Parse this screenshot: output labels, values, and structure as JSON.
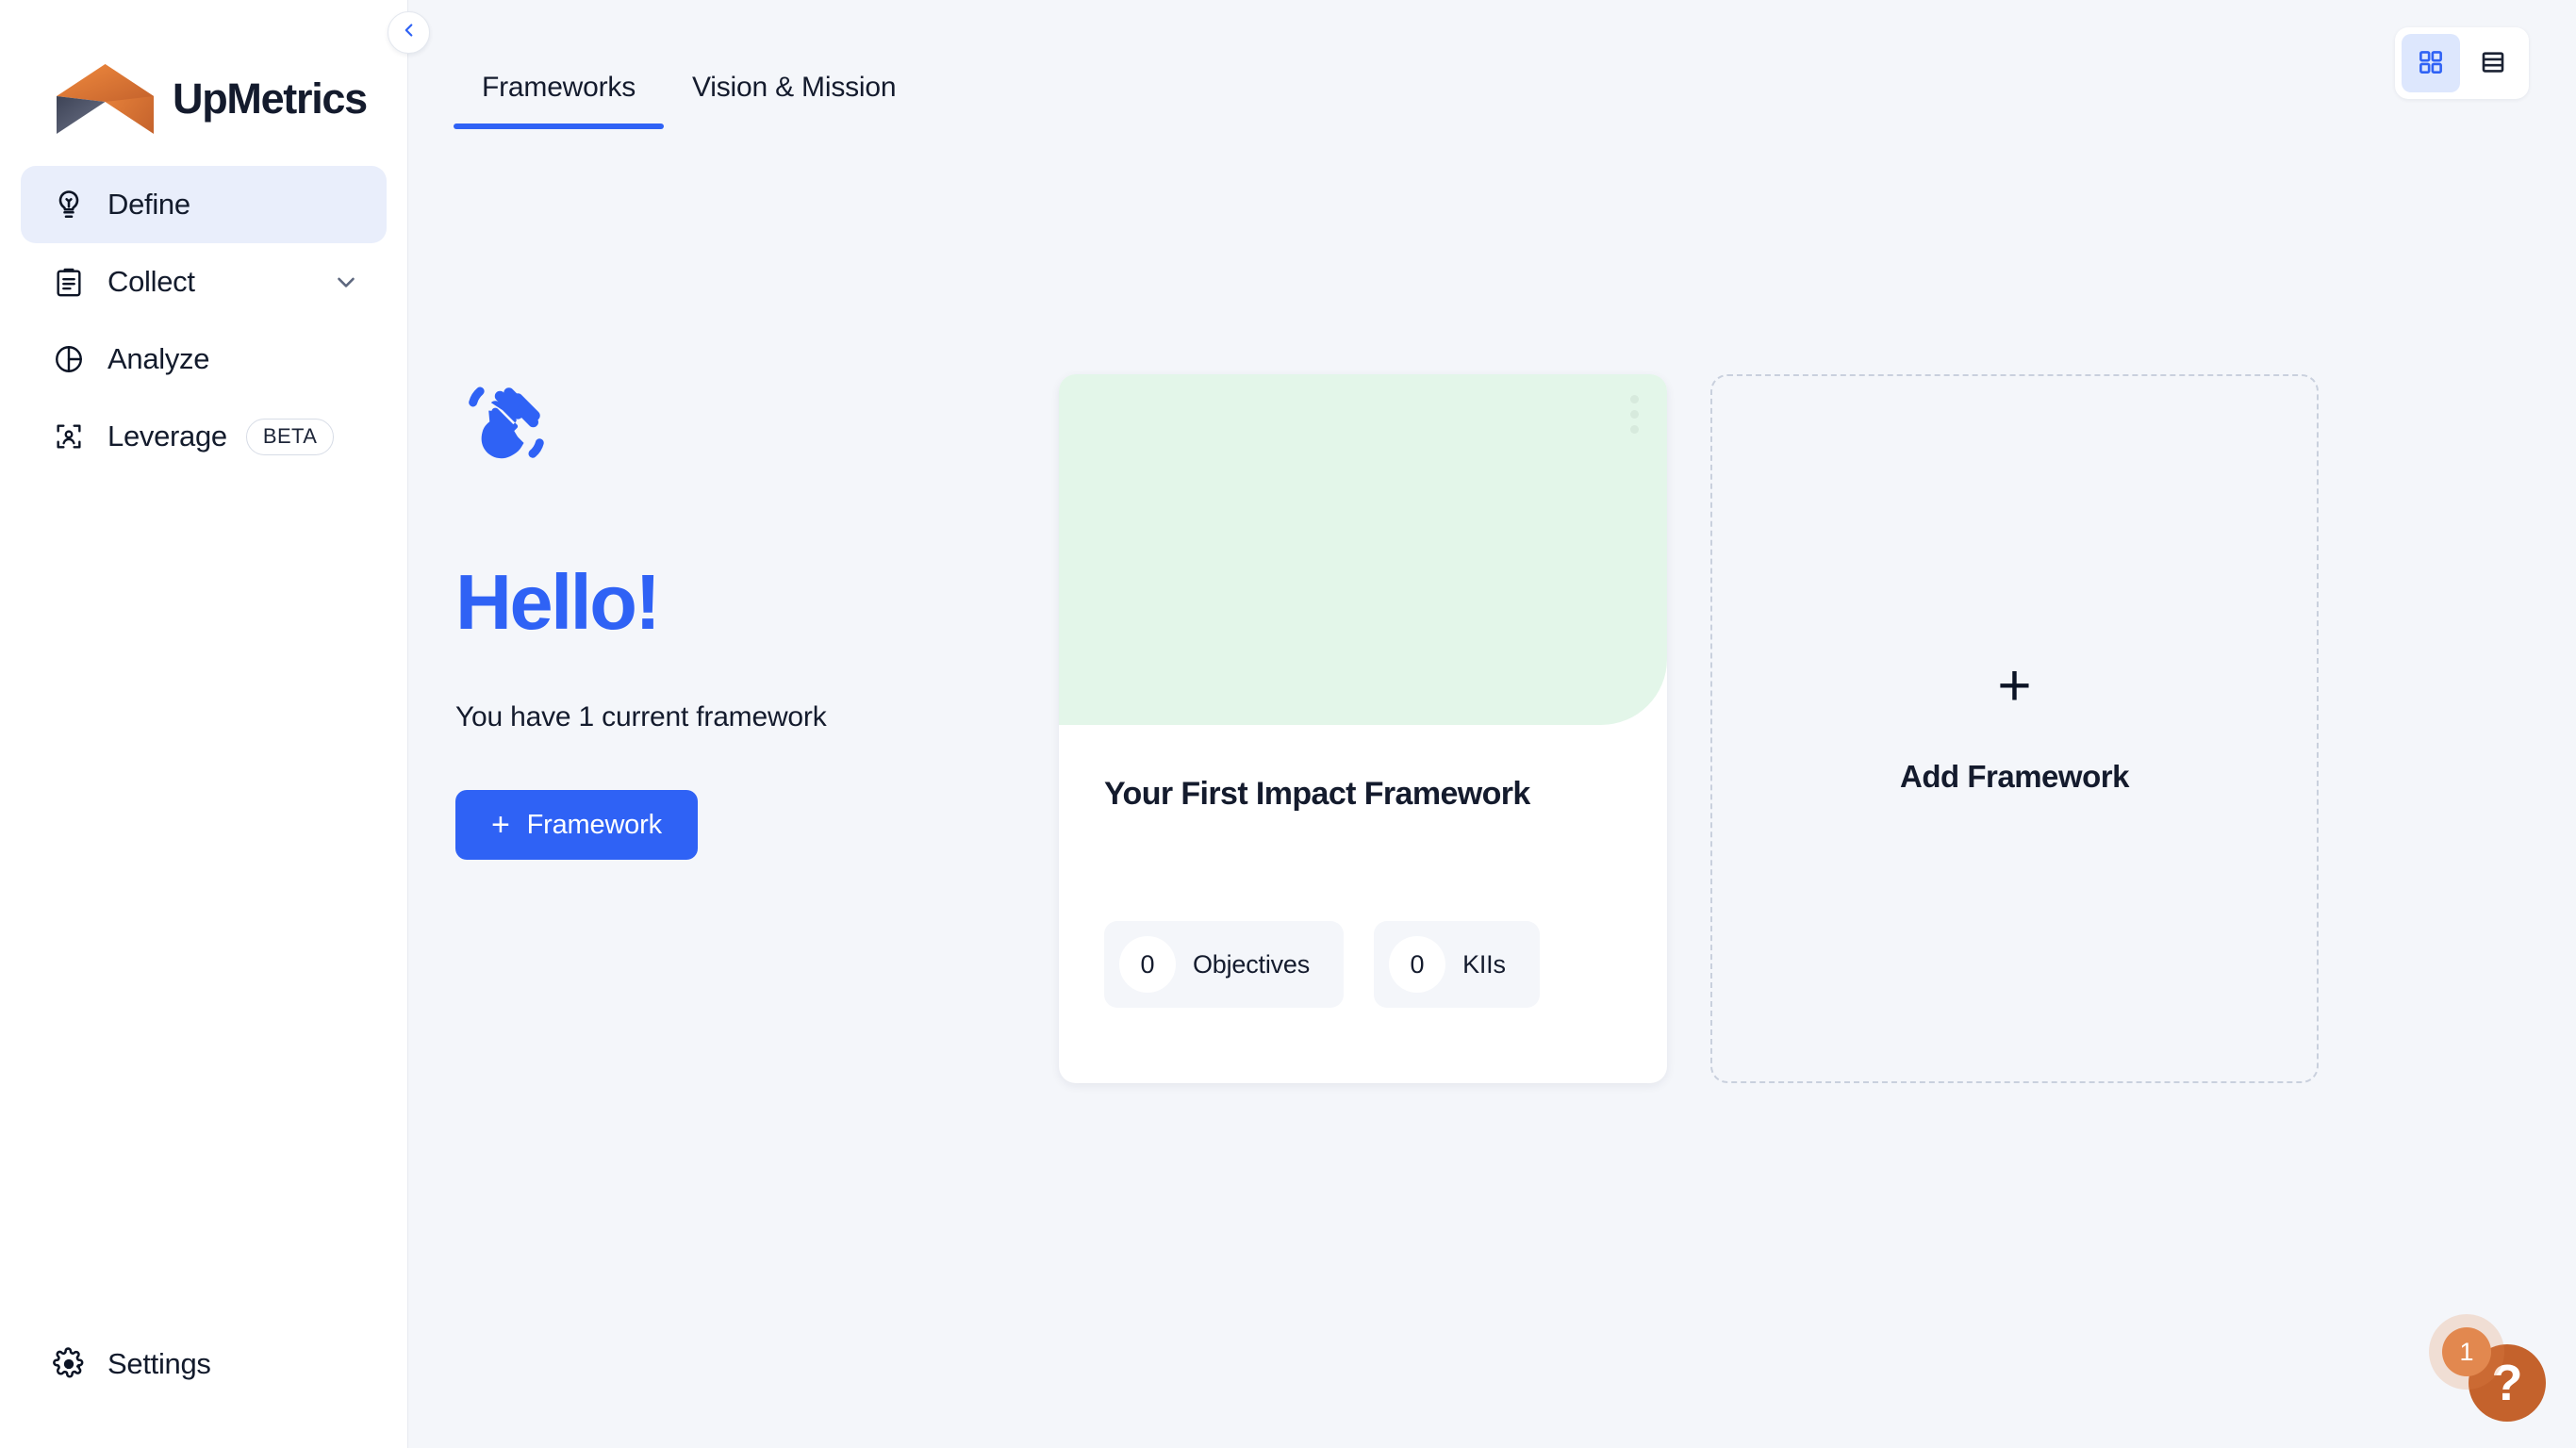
{
  "brand": {
    "name": "UpMetrics",
    "logo_icon": "upmetrics-logo-mark"
  },
  "sidebar": {
    "collapse_toggle_icon": "chevron-left-icon",
    "items": [
      {
        "label": "Define",
        "icon": "lightbulb-icon",
        "active": true
      },
      {
        "label": "Collect",
        "icon": "clipboard-icon",
        "active": false,
        "expand_icon": "chevron-down-icon"
      },
      {
        "label": "Analyze",
        "icon": "pie-chart-icon",
        "active": false
      },
      {
        "label": "Leverage",
        "icon": "user-card-icon",
        "active": false,
        "badge": "BETA"
      }
    ],
    "bottom": {
      "label": "Settings",
      "icon": "gear-icon"
    }
  },
  "topbar": {
    "tabs": [
      {
        "label": "Frameworks",
        "active": true
      },
      {
        "label": "Vision & Mission",
        "active": false
      }
    ],
    "view_toggle": [
      {
        "icon": "grid-view-icon",
        "active": true
      },
      {
        "icon": "list-view-icon",
        "active": false
      }
    ]
  },
  "hero": {
    "wave_icon": "waving-hand-icon",
    "greeting": "Hello!",
    "subtitle": "You have 1 current framework",
    "cta": {
      "label": "Framework",
      "icon": "plus-icon"
    }
  },
  "frameworks": [
    {
      "title": "Your First Impact Framework",
      "cover_color": "#e3f6e9",
      "menu_icon": "more-vertical-icon",
      "stats": [
        {
          "count": "0",
          "label": "Objectives"
        },
        {
          "count": "0",
          "label": "KIIs"
        }
      ]
    }
  ],
  "add_card": {
    "icon": "plus-icon",
    "label": "Add Framework"
  },
  "help": {
    "icon": "question-mark-icon",
    "badge": "1"
  },
  "colors": {
    "accent_blue": "#2f62f5",
    "active_nav_bg": "#e9eefb",
    "page_bg": "#f4f6fa",
    "card_cover_green": "#e3f6e9",
    "help_orange": "#c4622c",
    "badge_orange": "#e2884f",
    "text_dark": "#141b2d"
  }
}
